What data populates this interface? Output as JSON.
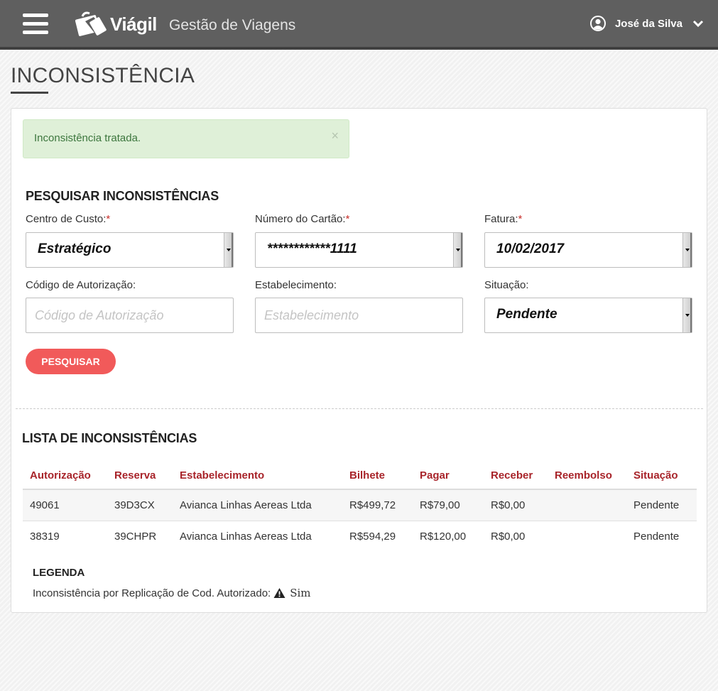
{
  "header": {
    "logo_text": "Viágil",
    "subtitle": "Gestão de Viagens",
    "user_name": "José da Silva"
  },
  "page": {
    "title": "INCONSISTÊNCIA"
  },
  "alert": {
    "message": "Inconsistência tratada.",
    "close_glyph": "×"
  },
  "search": {
    "title": "PESQUISAR INCONSISTÊNCIAS",
    "required_mark": "*",
    "fields": {
      "cost_center": {
        "label": "Centro de Custo:",
        "value": "Estratégico"
      },
      "card_number": {
        "label": "Número do Cartão:",
        "value": "************1111"
      },
      "invoice": {
        "label": "Fatura:",
        "value": "10/02/2017"
      },
      "auth_code": {
        "label": "Código de Autorização:",
        "placeholder": "Código de Autorização",
        "value": ""
      },
      "establishment": {
        "label": "Estabelecimento:",
        "placeholder": "Estabelecimento",
        "value": ""
      },
      "status": {
        "label": "Situação:",
        "value": "Pendente"
      }
    },
    "button_label": "PESQUISAR"
  },
  "list": {
    "title": "LISTA DE INCONSISTÊNCIAS",
    "columns": [
      "Autorização",
      "Reserva",
      "Estabelecimento",
      "Bilhete",
      "Pagar",
      "Receber",
      "Reembolso",
      "Situação"
    ],
    "rows": [
      [
        "49061",
        "39D3CX",
        "Avianca Linhas Aereas Ltda",
        "R$499,72",
        "R$79,00",
        "R$0,00",
        "",
        "Pendente"
      ],
      [
        "38319",
        "39CHPR",
        "Avianca Linhas Aereas Ltda",
        "R$594,29",
        "R$120,00",
        "R$0,00",
        "",
        "Pendente"
      ]
    ]
  },
  "legend": {
    "title": "LEGENDA",
    "text": "Inconsistência por Replicação de Cod. Autorizado:",
    "icon": "warning-icon",
    "value": "Sim"
  },
  "colors": {
    "header_bg": "#5f5f5f",
    "accent_red": "#a8242a",
    "button_bg": "#f15a5a",
    "alert_bg": "#dff0d8",
    "alert_text": "#3c763d"
  }
}
